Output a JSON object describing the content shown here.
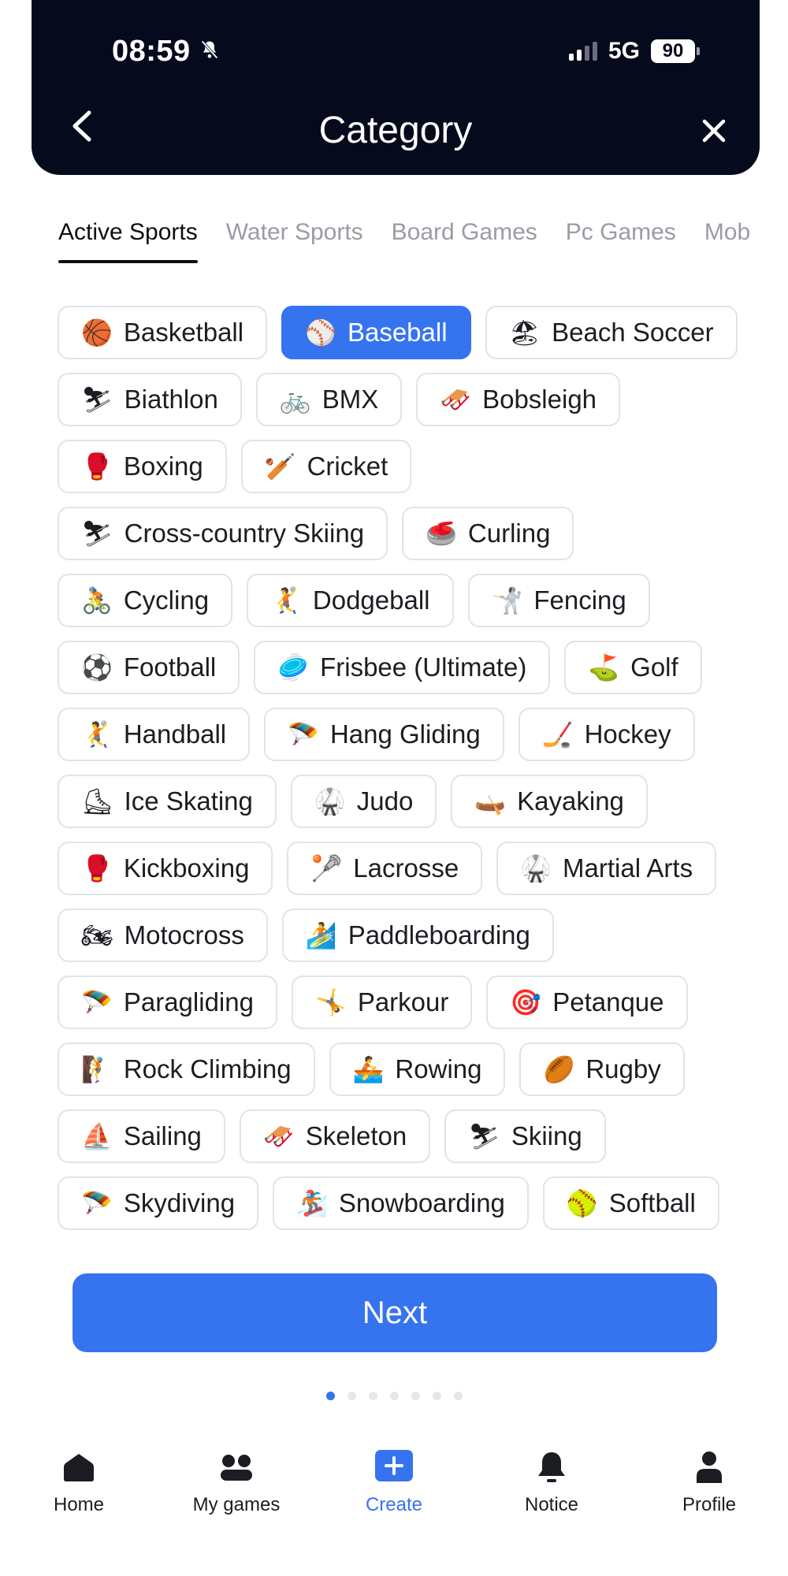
{
  "status_bar": {
    "time": "08:59",
    "network": "5G",
    "battery": "90",
    "icons": [
      "bell-slash-icon",
      "signal-icon",
      "battery-icon"
    ]
  },
  "header": {
    "title": "Category",
    "back_icon": "chevron-left-icon",
    "close_icon": "close-icon"
  },
  "tabs": [
    {
      "label": "Active Sports",
      "active": true
    },
    {
      "label": "Water Sports"
    },
    {
      "label": "Board Games"
    },
    {
      "label": "Pc Games"
    },
    {
      "label": "Mob"
    }
  ],
  "categories": [
    {
      "icon": "🏀",
      "label": "Basketball"
    },
    {
      "icon": "⚾",
      "label": "Baseball",
      "selected": true
    },
    {
      "icon": "🏖",
      "label": "Beach Soccer"
    },
    {
      "icon": "⛷",
      "label": "Biathlon"
    },
    {
      "icon": "🚲",
      "label": "BMX"
    },
    {
      "icon": "🛷",
      "label": "Bobsleigh"
    },
    {
      "icon": "🥊",
      "label": "Boxing"
    },
    {
      "icon": "🏏",
      "label": "Cricket"
    },
    {
      "icon": "⛷",
      "label": "Cross-country Skiing"
    },
    {
      "icon": "🥌",
      "label": "Curling"
    },
    {
      "icon": "🚴",
      "label": "Cycling"
    },
    {
      "icon": "🤾",
      "label": "Dodgeball"
    },
    {
      "icon": "🤺",
      "label": "Fencing"
    },
    {
      "icon": "⚽",
      "label": "Football"
    },
    {
      "icon": "🥏",
      "label": "Frisbee (Ultimate)"
    },
    {
      "icon": "⛳",
      "label": "Golf"
    },
    {
      "icon": "🤾",
      "label": "Handball"
    },
    {
      "icon": "🪂",
      "label": "Hang Gliding"
    },
    {
      "icon": "🏒",
      "label": "Hockey"
    },
    {
      "icon": "⛸",
      "label": "Ice Skating"
    },
    {
      "icon": "🥋",
      "label": "Judo"
    },
    {
      "icon": "🛶",
      "label": "Kayaking"
    },
    {
      "icon": "🥊",
      "label": "Kickboxing"
    },
    {
      "icon": "🥍",
      "label": "Lacrosse"
    },
    {
      "icon": "🥋",
      "label": "Martial Arts"
    },
    {
      "icon": "🏍",
      "label": "Motocross"
    },
    {
      "icon": "🏄",
      "label": "Paddleboarding"
    },
    {
      "icon": "🪂",
      "label": "Paragliding"
    },
    {
      "icon": "🤸",
      "label": "Parkour"
    },
    {
      "icon": "🎯",
      "label": "Petanque"
    },
    {
      "icon": "🧗",
      "label": "Rock Climbing"
    },
    {
      "icon": "🚣",
      "label": "Rowing"
    },
    {
      "icon": "🏉",
      "label": "Rugby"
    },
    {
      "icon": "⛵",
      "label": "Sailing"
    },
    {
      "icon": "🛷",
      "label": "Skeleton"
    },
    {
      "icon": "⛷",
      "label": "Skiing"
    },
    {
      "icon": "🪂",
      "label": "Skydiving"
    },
    {
      "icon": "🏂",
      "label": "Snowboarding"
    },
    {
      "icon": "🥎",
      "label": "Softball"
    }
  ],
  "next_button": {
    "label": "Next"
  },
  "pagination": {
    "total": 7,
    "current": 1
  },
  "bottom_nav": [
    {
      "label": "Home",
      "icon": "home-icon"
    },
    {
      "label": "My games",
      "icon": "my-games-icon"
    },
    {
      "label": "Create",
      "icon": "create-plus-icon",
      "active": true
    },
    {
      "label": "Notice",
      "icon": "bell-icon"
    },
    {
      "label": "Profile",
      "icon": "profile-icon"
    }
  ],
  "colors": {
    "accent": "#3673ef",
    "header_bg": "#050a1c",
    "chip_border": "#e2e3e7",
    "tab_inactive": "#9a9ca3"
  }
}
